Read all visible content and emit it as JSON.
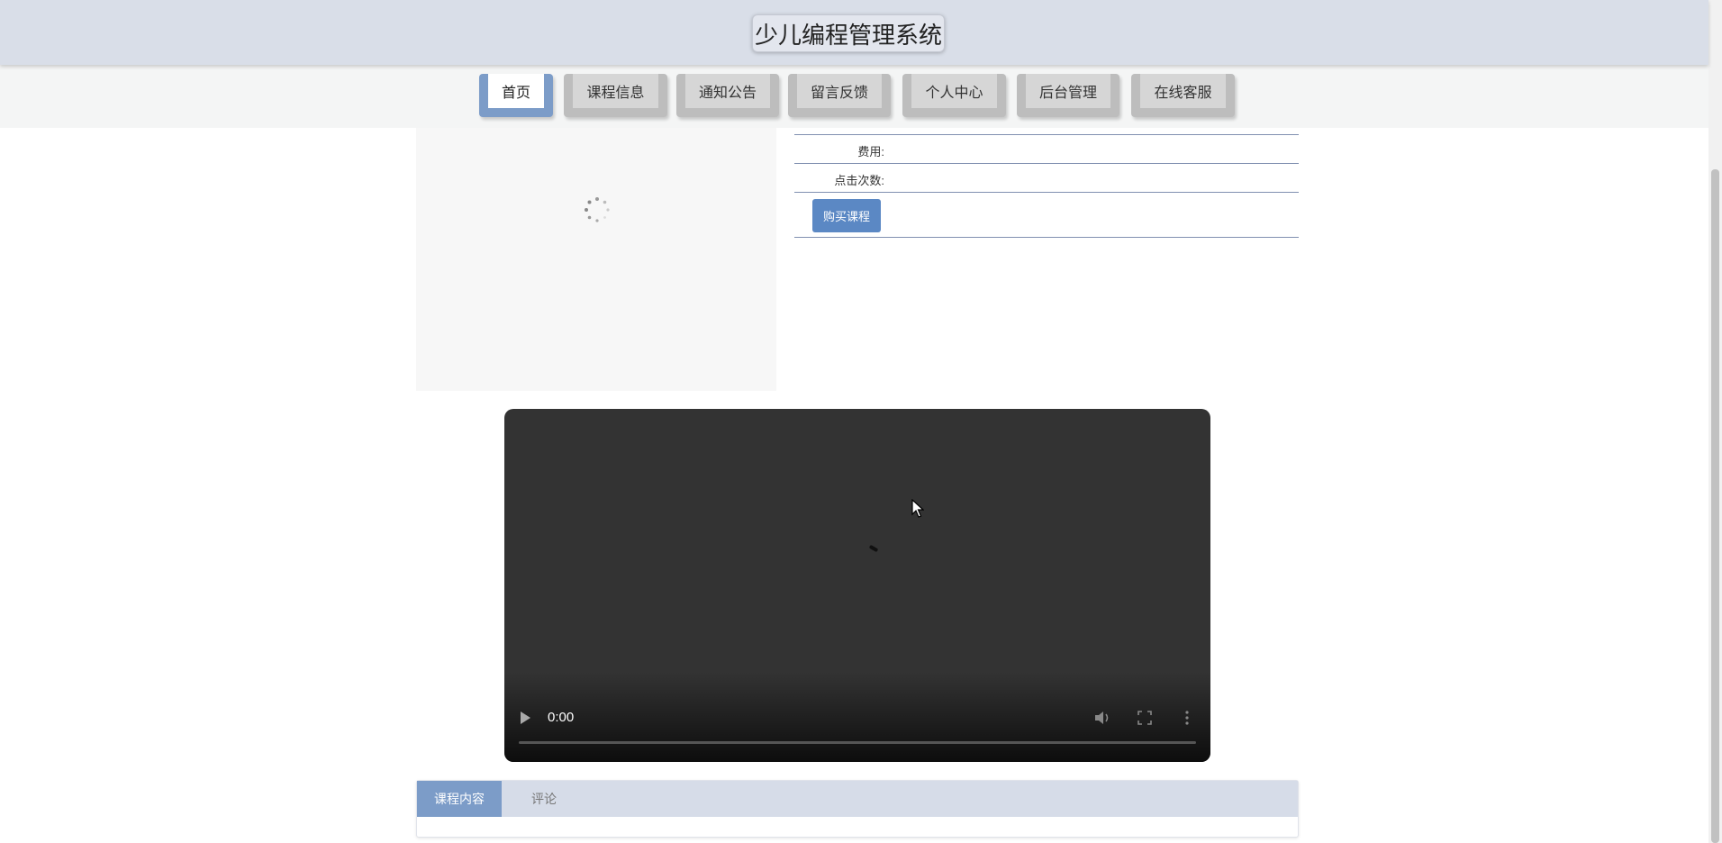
{
  "header": {
    "title": "少儿编程管理系统"
  },
  "nav": {
    "items": [
      {
        "label": "首页",
        "active": true
      },
      {
        "label": "课程信息",
        "active": false
      },
      {
        "label": "通知公告",
        "active": false
      },
      {
        "label": "留言反馈",
        "active": false
      },
      {
        "label": "个人中心",
        "active": false
      },
      {
        "label": "后台管理",
        "active": false
      },
      {
        "label": "在线客服",
        "active": false
      }
    ]
  },
  "detail": {
    "fee_label": "费用:",
    "clicks_label": "点击次数:",
    "buy_button": "购买课程"
  },
  "video": {
    "time": "0:00",
    "icons": [
      "play-icon",
      "volume-icon",
      "fullscreen-icon",
      "more-options-icon"
    ]
  },
  "tabs": {
    "items": [
      {
        "label": "课程内容",
        "active": true
      },
      {
        "label": "评论",
        "active": false
      }
    ]
  },
  "colors": {
    "accent": "#7c9cc8",
    "button": "#5b88c4",
    "header_bg": "#d9dee8"
  }
}
